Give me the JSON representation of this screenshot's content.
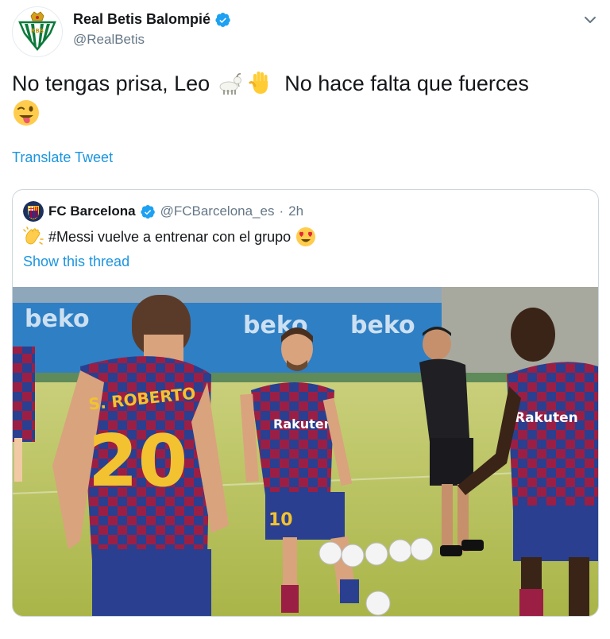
{
  "author": {
    "name": "Real Betis Balompié",
    "handle": "@RealBetis",
    "avatar_icon": "real-betis-crest-icon"
  },
  "tweet": {
    "text_part1": "No tengas prisa, Leo",
    "text_part2": "No hace falta que fuerces",
    "emojis": [
      "goat-emoji",
      "raised-hand-emoji",
      "winking-tongue-emoji"
    ]
  },
  "translate_label": "Translate Tweet",
  "quoted": {
    "name": "FC Barcelona",
    "handle": "@FCBarcelona_es",
    "separator": "·",
    "time": "2h",
    "text": "#Messi vuelve a entrenar con el grupo",
    "emojis": [
      "clapping-hands-emoji",
      "heart-eyes-emoji"
    ],
    "show_thread_label": "Show this thread",
    "media": {
      "banner_text": "beko",
      "shirt_sponsor": "Rakuten",
      "player_name": "S. ROBERTO",
      "player_number": "20",
      "messi_number": "10"
    }
  },
  "colors": {
    "link": "#1b95e0",
    "secondary": "#657786",
    "verified": "#1da1f2",
    "border": "#ccd6dd"
  }
}
